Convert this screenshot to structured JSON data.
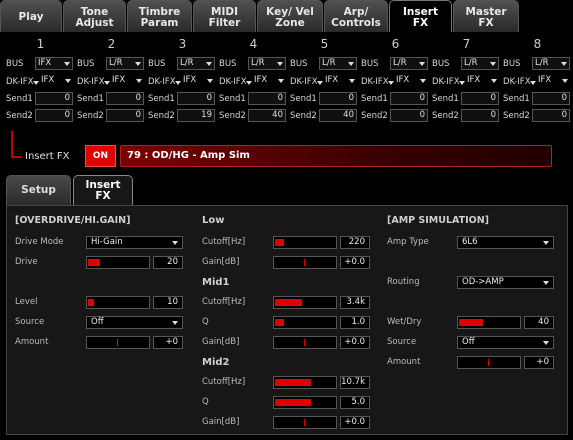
{
  "tabs": [
    {
      "label": "Play",
      "active": false
    },
    {
      "label": "Tone\nAdjust",
      "active": false
    },
    {
      "label": "Timbre\nParam",
      "active": false
    },
    {
      "label": "MIDI\nFilter",
      "active": false
    },
    {
      "label": "Key/ Vel\nZone",
      "active": false
    },
    {
      "label": "Arp/\nControls",
      "active": false
    },
    {
      "label": "Insert\nFX",
      "active": true
    },
    {
      "label": "Master\nFX",
      "active": false
    }
  ],
  "routing_labels": {
    "bus": "BUS",
    "dkifx": "DK-IFX",
    "send1": "Send1",
    "send2": "Send2"
  },
  "channels": [
    {
      "num": "1",
      "bus": "IFX",
      "dk": "IFX",
      "send1": "0",
      "send2": "0"
    },
    {
      "num": "2",
      "bus": "L/R",
      "dk": "IFX",
      "send1": "0",
      "send2": "0"
    },
    {
      "num": "3",
      "bus": "L/R",
      "dk": "IFX",
      "send1": "0",
      "send2": "19"
    },
    {
      "num": "4",
      "bus": "L/R",
      "dk": "IFX",
      "send1": "0",
      "send2": "40"
    },
    {
      "num": "5",
      "bus": "L/R",
      "dk": "IFX",
      "send1": "0",
      "send2": "40"
    },
    {
      "num": "6",
      "bus": "L/R",
      "dk": "IFX",
      "send1": "0",
      "send2": "0"
    },
    {
      "num": "7",
      "bus": "L/R",
      "dk": "IFX",
      "send1": "0",
      "send2": "0"
    },
    {
      "num": "8",
      "bus": "L/R",
      "dk": "IFX",
      "send1": "0",
      "send2": "0"
    }
  ],
  "insert": {
    "label": "Insert FX",
    "on_label": "ON",
    "fx_name": "79 : OD/HG - Amp Sim"
  },
  "subtabs": [
    {
      "label": "Setup",
      "active": false
    },
    {
      "label": "Insert\nFX",
      "active": true
    }
  ],
  "overdrive": {
    "title": "[OVERDRIVE/HI.GAIN]",
    "drive_mode": {
      "label": "Drive Mode",
      "value": "Hi-Gain"
    },
    "drive": {
      "label": "Drive",
      "value": "20",
      "level": 0.2
    },
    "level": {
      "label": "Level",
      "value": "10",
      "level": 0.1
    },
    "source": {
      "label": "Source",
      "value": "Off"
    },
    "amount": {
      "label": "Amount",
      "value": "+0",
      "level": 0.5
    }
  },
  "eq": {
    "low": {
      "title": "Low",
      "cutoff": {
        "label": "Cutoff[Hz]",
        "value": "220",
        "level": 0.15
      },
      "gain": {
        "label": "Gain[dB]",
        "value": "+0.0",
        "level": 0.5
      }
    },
    "mid1": {
      "title": "Mid1",
      "cutoff": {
        "label": "Cutoff[Hz]",
        "value": "3.4k",
        "level": 0.45
      },
      "q": {
        "label": "Q",
        "value": "1.0",
        "level": 0.15
      },
      "gain": {
        "label": "Gain[dB]",
        "value": "+0.0",
        "level": 0.5
      }
    },
    "mid2": {
      "title": "Mid2",
      "cutoff": {
        "label": "Cutoff[Hz]",
        "value": "10.7k",
        "level": 0.6
      },
      "q": {
        "label": "Q",
        "value": "5.0",
        "level": 0.6
      },
      "gain": {
        "label": "Gain[dB]",
        "value": "+0.0",
        "level": 0.5
      }
    }
  },
  "amp": {
    "title": "[AMP SIMULATION]",
    "amp_type": {
      "label": "Amp Type",
      "value": "6L6"
    },
    "routing": {
      "label": "Routing",
      "value": "OD->AMP"
    },
    "wetdry": {
      "label": "Wet/Dry",
      "value": "40",
      "level": 0.4
    },
    "source": {
      "label": "Source",
      "value": "Off"
    },
    "amount": {
      "label": "Amount",
      "value": "+0",
      "level": 0.5
    }
  },
  "colors": {
    "accent": "#e00000",
    "background": "#000000",
    "panel": "#171717"
  }
}
